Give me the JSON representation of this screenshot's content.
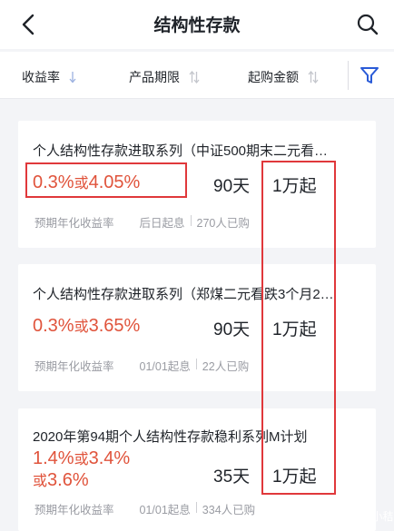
{
  "header": {
    "title": "结构性存款"
  },
  "filters": [
    {
      "label": "收益率",
      "icon": "arrow-down-icon"
    },
    {
      "label": "产品期限",
      "icon": "sort-updown-icon"
    },
    {
      "label": "起购金额",
      "icon": "sort-updown-icon"
    }
  ],
  "products": [
    {
      "title": "个人结构性存款进取系列（中证500期末二元看…",
      "rate_low": "0.3%",
      "rate_or": "或",
      "rate_high": "4.05%",
      "term": "90天",
      "min_amount": "1万起",
      "rate_label": "预期年化收益率",
      "start": "后日起息",
      "buyers": "270人已购"
    },
    {
      "title": "个人结构性存款进取系列（郑煤二元看跌3个月2…",
      "rate_low": "0.3%",
      "rate_or": "或",
      "rate_high": "3.65%",
      "term": "90天",
      "min_amount": "1万起",
      "rate_label": "预期年化收益率",
      "start": "01/01起息",
      "buyers": "22人已购"
    },
    {
      "title": "2020年第94期个人结构性存款稳利系列M计划",
      "rate_low": "1.4%",
      "rate_or": "或",
      "rate_high": "3.4%",
      "rate_or2": "或",
      "rate_third": "3.6%",
      "term": "35天",
      "min_amount": "1万起",
      "rate_label": "预期年化收益率",
      "start": "01/01起息",
      "buyers": "334人已购"
    }
  ],
  "watermark": {
    "text": "知乎 @小秸妹"
  },
  "colors": {
    "accent_rate": "#e0533b",
    "annotation_red": "#e0383b",
    "icon_blue": "#2a5bd7"
  }
}
